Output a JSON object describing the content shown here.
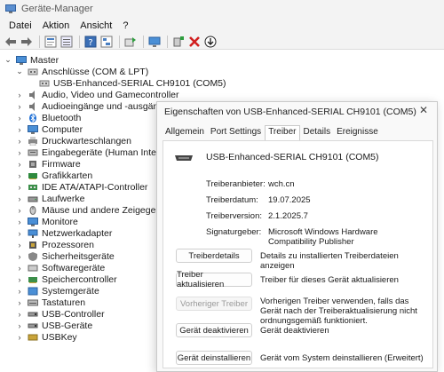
{
  "window": {
    "title": "Geräte-Manager"
  },
  "menu": {
    "items": [
      "Datei",
      "Aktion",
      "Ansicht",
      "?"
    ]
  },
  "toolbar": {
    "icons": [
      "back-arrow-icon",
      "forward-arrow-icon",
      "properties-icon",
      "list-icon",
      "help-icon",
      "tree-view-icon",
      "update-driver-icon",
      "monitor-icon",
      "add-driver-icon",
      "uninstall-icon",
      "download-icon"
    ]
  },
  "tree": {
    "root": "Master",
    "items": [
      {
        "label": "Anschlüsse (COM & LPT)",
        "expanded": true
      },
      {
        "label": "USB-Enhanced-SERIAL CH9101 (COM5)",
        "child": true
      },
      {
        "label": "Audio, Video und Gamecontroller"
      },
      {
        "label": "Audioeingänge und -ausgänge"
      },
      {
        "label": "Bluetooth"
      },
      {
        "label": "Computer"
      },
      {
        "label": "Druckwarteschlangen"
      },
      {
        "label": "Eingabegeräte (Human Interface D"
      },
      {
        "label": "Firmware"
      },
      {
        "label": "Grafikkarten"
      },
      {
        "label": "IDE ATA/ATAPI-Controller"
      },
      {
        "label": "Laufwerke"
      },
      {
        "label": "Mäuse und andere Zeigegeräte"
      },
      {
        "label": "Monitore"
      },
      {
        "label": "Netzwerkadapter"
      },
      {
        "label": "Prozessoren"
      },
      {
        "label": "Sicherheitsgeräte"
      },
      {
        "label": "Softwaregeräte"
      },
      {
        "label": "Speichercontroller"
      },
      {
        "label": "Systemgeräte"
      },
      {
        "label": "Tastaturen"
      },
      {
        "label": "USB-Controller"
      },
      {
        "label": "USB-Geräte"
      },
      {
        "label": "USBKey"
      }
    ]
  },
  "dialog": {
    "title": "Eigenschaften von USB-Enhanced-SERIAL CH9101 (COM5)",
    "close": "✕",
    "tabs": [
      "Allgemein",
      "Port Settings",
      "Treiber",
      "Details",
      "Ereignisse"
    ],
    "active_tab": "Treiber",
    "device_name": "USB-Enhanced-SERIAL CH9101 (COM5)",
    "props": [
      {
        "label": "Treiberanbieter:",
        "value": "wch.cn"
      },
      {
        "label": "Treiberdatum:",
        "value": "19.07.2025"
      },
      {
        "label": "Treiberversion:",
        "value": "2.1.2025.7"
      },
      {
        "label": "Signaturgeber:",
        "value": "Microsoft Windows Hardware Compatibility Publisher"
      }
    ],
    "buttons": [
      {
        "label": "Treiberdetails",
        "desc": "Details zu installierten Treiberdateien anzeigen",
        "enabled": true
      },
      {
        "label": "Treiber aktualisieren",
        "desc": "Treiber für dieses Gerät aktualisieren",
        "enabled": true
      },
      {
        "label": "Vorheriger Treiber",
        "desc": "Vorherigen Treiber verwenden, falls das Gerät nach der Treiberaktualisierung nicht ordnungsgemäß funktioniert.",
        "enabled": false
      },
      {
        "label": "Gerät deaktivieren",
        "desc": "Gerät deaktivieren",
        "enabled": true
      },
      {
        "label": "Gerät deinstallieren",
        "desc": "Gerät vom System deinstallieren (Erweitert)",
        "enabled": true
      }
    ]
  }
}
